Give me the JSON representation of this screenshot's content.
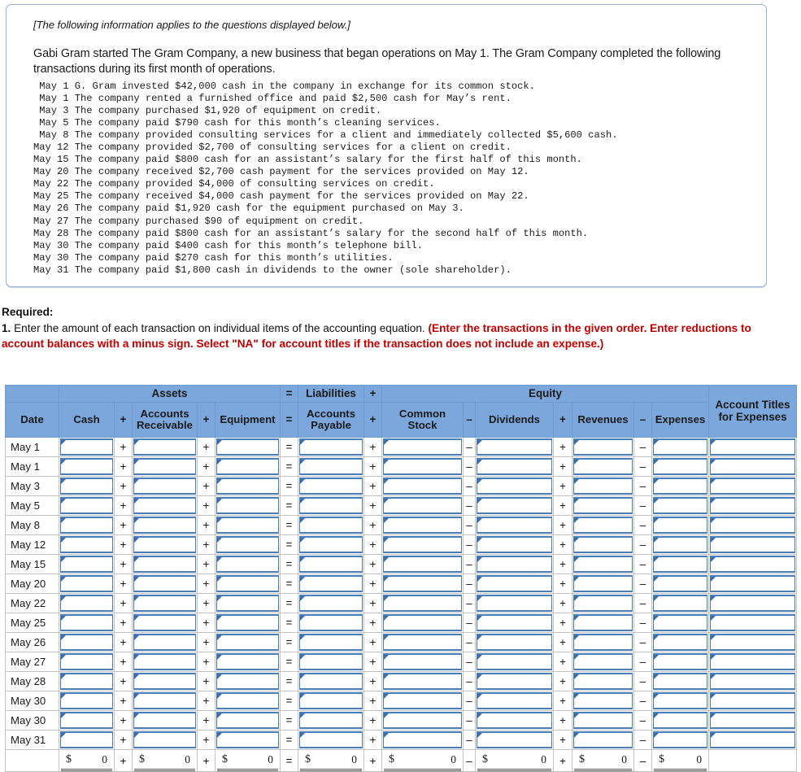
{
  "info": {
    "note": "[The following information applies to the questions displayed below.]",
    "intro": "Gabi Gram started The Gram Company, a new business that began operations on May 1. The Gram Company completed the following transactions during its first month of operations.",
    "transactions": [
      {
        "date": "May 1",
        "desc": "G. Gram invested $42,000 cash in the company in exchange for its common stock."
      },
      {
        "date": "May 1",
        "desc": "The company rented a furnished office and paid $2,500 cash for May’s rent."
      },
      {
        "date": "May 3",
        "desc": "The company purchased $1,920 of equipment on credit."
      },
      {
        "date": "May 5",
        "desc": "The company paid $790 cash for this month’s cleaning services."
      },
      {
        "date": "May 8",
        "desc": "The company provided consulting services for a client and immediately collected $5,600 cash."
      },
      {
        "date": "May 12",
        "desc": "The company provided $2,700 of consulting services for a client on credit."
      },
      {
        "date": "May 15",
        "desc": "The company paid $800 cash for an assistant’s salary for the first half of this month."
      },
      {
        "date": "May 20",
        "desc": "The company received $2,700 cash payment for the services provided on May 12."
      },
      {
        "date": "May 22",
        "desc": "The company provided $4,000 of consulting services on credit."
      },
      {
        "date": "May 25",
        "desc": "The company received $4,000 cash payment for the services provided on May 22."
      },
      {
        "date": "May 26",
        "desc": "The company paid $1,920 cash for the equipment purchased on May 3."
      },
      {
        "date": "May 27",
        "desc": "The company purchased $90 of equipment on credit."
      },
      {
        "date": "May 28",
        "desc": "The company paid $800 cash for an assistant’s salary for the second half of this month."
      },
      {
        "date": "May 30",
        "desc": "The company paid $400 cash for this month’s telephone bill."
      },
      {
        "date": "May 30",
        "desc": "The company paid $270 cash for this month’s utilities."
      },
      {
        "date": "May 31",
        "desc": "The company paid $1,800 cash in dividends to the owner (sole shareholder)."
      }
    ]
  },
  "required": {
    "label": "Required:",
    "number": "1.",
    "plain_text": " Enter the amount of each transaction on individual items of the accounting equation. ",
    "emphasis": "(Enter the transactions in the given order. Enter reductions to account balances with a minus sign. Select \"NA\" for account titles if the transaction does not include an expense.)",
    "emphasis_color": "#c00000"
  },
  "worksheet": {
    "group_headers": [
      {
        "label": "",
        "span": 1
      },
      {
        "label": "Assets",
        "span": 5
      },
      {
        "label": "=",
        "span": 1
      },
      {
        "label": "Liabilities",
        "span": 1
      },
      {
        "label": "+",
        "span": 1
      },
      {
        "label": "Equity",
        "span": 7
      },
      {
        "label": "",
        "span": 1
      }
    ],
    "column_headers": [
      "Date",
      "Cash",
      "+",
      "Accounts Receivable",
      "+",
      "Equipment",
      "=",
      "Accounts Payable",
      "+",
      "Common Stock",
      "–",
      "Dividends",
      "+",
      "Revenues",
      "–",
      "Expenses",
      "Account Titles for Expenses"
    ],
    "operators": [
      "+",
      "+",
      "=",
      "+",
      "–",
      "+",
      "–"
    ],
    "row_dates": [
      "May 1",
      "May 1",
      "May 3",
      "May 5",
      "May 8",
      "May 12",
      "May 15",
      "May 20",
      "May 22",
      "May 25",
      "May 26",
      "May 27",
      "May 28",
      "May 30",
      "May 30",
      "May 31"
    ],
    "input_value": "",
    "totals": {
      "currency": "$",
      "cash": "0",
      "accounts_receivable": "0",
      "equipment": "0",
      "accounts_payable": "0",
      "common_stock": "0",
      "dividends": "0",
      "revenues": "0",
      "expenses": "0",
      "account_titles": ""
    },
    "header_bg": "#7ba7dc",
    "input_border": "#4a7ebb"
  }
}
